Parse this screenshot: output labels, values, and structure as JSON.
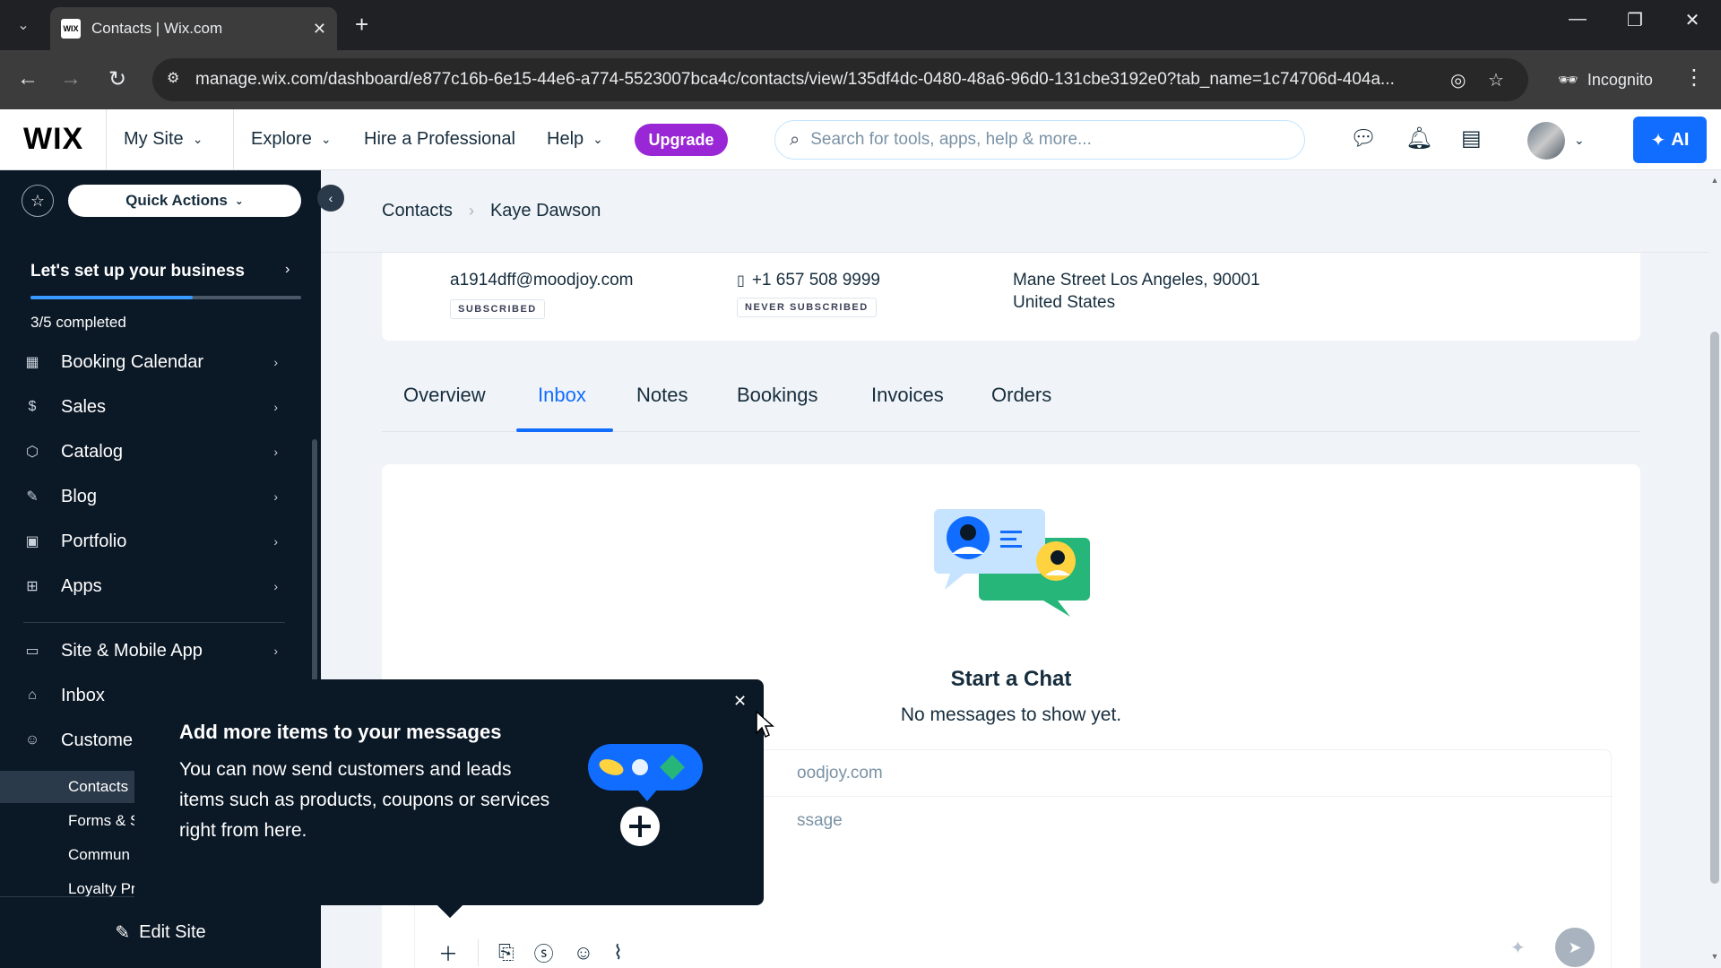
{
  "browser": {
    "tab_title": "Contacts | Wix.com",
    "favicon_text": "WIX",
    "url": "manage.wix.com/dashboard/e877c16b-6e15-44e6-a774-5523007bca4c/contacts/view/135df4dc-0480-48a6-96d0-131cbe3192e0?tab_name=1c74706d-404a...",
    "incognito_label": "Incognito"
  },
  "wix_header": {
    "logo": "WIX",
    "my_site": "My Site",
    "explore": "Explore",
    "hire": "Hire a Professional",
    "help": "Help",
    "upgrade": "Upgrade",
    "search_placeholder": "Search for tools, apps, help & more...",
    "ai_label": "AI"
  },
  "sidebar": {
    "quick_actions": "Quick Actions",
    "setup_title": "Let's set up your business",
    "setup_progress": 0.6,
    "setup_count": "3/5 completed",
    "items": [
      {
        "label": "Booking Calendar",
        "icon": "calendar-icon"
      },
      {
        "label": "Sales",
        "icon": "dollar-icon"
      },
      {
        "label": "Catalog",
        "icon": "catalog-icon"
      },
      {
        "label": "Blog",
        "icon": "pen-icon"
      },
      {
        "label": "Portfolio",
        "icon": "portfolio-icon"
      },
      {
        "label": "Apps",
        "icon": "apps-icon"
      },
      {
        "label": "Site & Mobile App",
        "icon": "site-icon"
      },
      {
        "label": "Inbox",
        "icon": "inbox-icon"
      },
      {
        "label": "Custome",
        "icon": "customers-icon"
      }
    ],
    "sub_items": [
      "Contacts",
      "Forms & S",
      "Commun",
      "Loyalty Pr"
    ],
    "edit_site": "Edit Site"
  },
  "breadcrumb": {
    "parent": "Contacts",
    "current": "Kaye Dawson"
  },
  "contact": {
    "email": "a1914dff@moodjoy.com",
    "email_status": "SUBSCRIBED",
    "phone": "+1 657 508 9999",
    "phone_status": "NEVER SUBSCRIBED",
    "address_line1": "Mane Street Los Angeles, 90001",
    "address_line2": "United States"
  },
  "tabs": [
    "Overview",
    "Inbox",
    "Notes",
    "Bookings",
    "Invoices",
    "Orders"
  ],
  "active_tab": "Inbox",
  "inbox": {
    "title": "Start a Chat",
    "subtitle": "No messages to show yet.",
    "to_value": "oodjoy.com",
    "message_placeholder": "ssage"
  },
  "popover": {
    "title": "Add more items to your messages",
    "body": "You can now send customers and leads items such as products, coupons or services right from here."
  },
  "colors": {
    "accent": "#116dff",
    "upgrade": "#9a27d5",
    "sidebar_bg": "#0b1826"
  }
}
